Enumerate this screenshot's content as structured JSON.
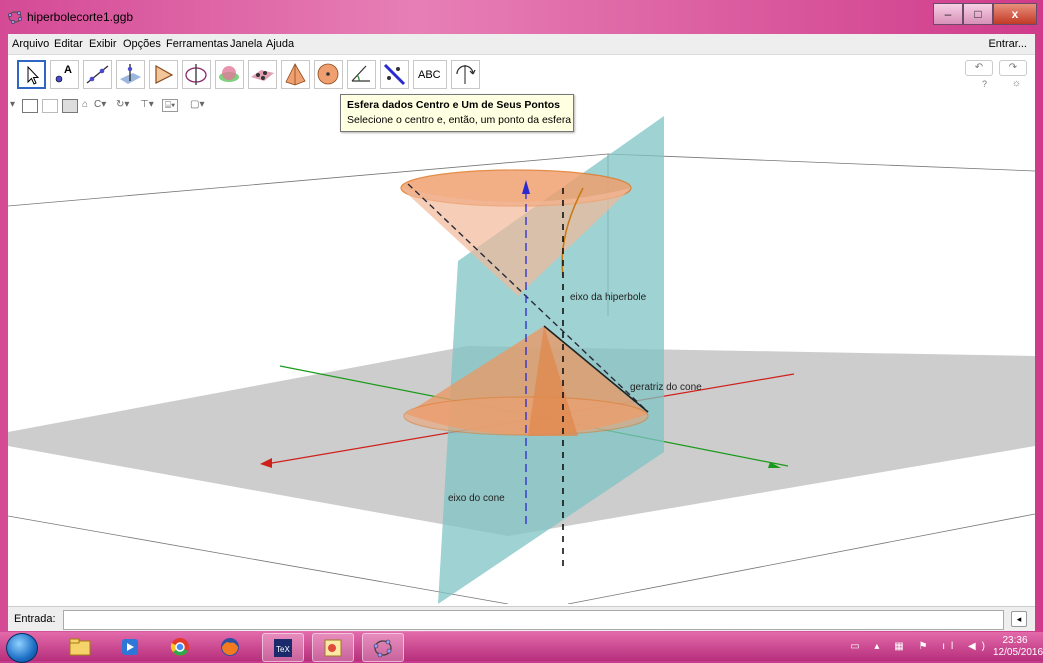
{
  "window": {
    "title": "hiperbolecorte1.ggb",
    "buttons": {
      "minimize": "–",
      "maximize": "□",
      "close": "x"
    }
  },
  "menubar": {
    "items": [
      "Arquivo",
      "Editar",
      "Exibir",
      "Opções",
      "Ferramentas",
      "Janela",
      "Ajuda"
    ],
    "signin": "Entrar..."
  },
  "toolbar": {
    "tools": [
      {
        "name": "move-tool"
      },
      {
        "name": "point-tool"
      },
      {
        "name": "line-tool"
      },
      {
        "name": "perpendicular-line-tool"
      },
      {
        "name": "polygon-tool"
      },
      {
        "name": "circle-axis-tool"
      },
      {
        "name": "intersect-surfaces-tool"
      },
      {
        "name": "plane-three-points-tool"
      },
      {
        "name": "pyramid-tool"
      },
      {
        "name": "sphere-tool"
      },
      {
        "name": "angle-tool"
      },
      {
        "name": "reflect-tool"
      },
      {
        "name": "text-tool",
        "label": "ABC"
      },
      {
        "name": "rotate-view-tool"
      }
    ],
    "undo": "↶",
    "redo": "↷",
    "help": "?",
    "settings": "☼"
  },
  "tooltip": {
    "title": "Esfera dados Centro e Um de Seus Pontos",
    "text": "Selecione o centro e, então, um ponto da esfera"
  },
  "graphics": {
    "labels": {
      "hyperbola_axis": "eixo da hiperbole",
      "cone_generatrix": "geratriz do cone",
      "cone_axis": "eixo do cone"
    },
    "colors": {
      "cone": "#f0a070",
      "cone_edge": "#e07a2a",
      "plane": "#7fc3c3",
      "floor": "#c8c8c8",
      "x_axis": "#d0201a",
      "y_axis": "#1a9a1a",
      "z_axis": "#2a2aa0"
    }
  },
  "inputbar": {
    "label": "Entrada:",
    "value": "",
    "help": "◂"
  },
  "taskbar": {
    "time": "23:36",
    "date": "12/05/2016"
  }
}
